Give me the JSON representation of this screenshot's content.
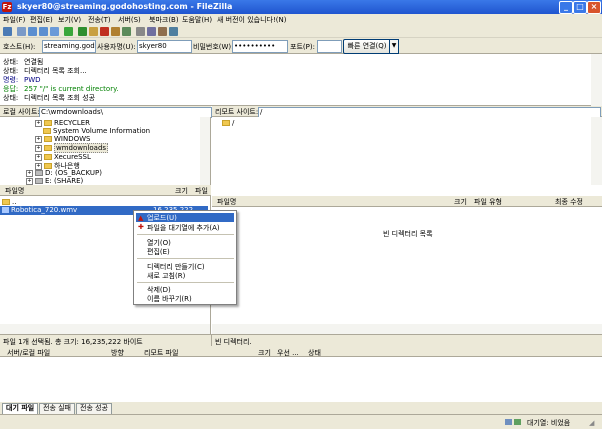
{
  "window": {
    "title": "skyer80@streaming.godohosting.com - FileZilla"
  },
  "menu": [
    "파일(F)",
    "편집(E)",
    "보기(V)",
    "전송(T)",
    "서버(S)",
    "북마크(B)",
    "도움말(H)",
    "새 버전이 있습니다!(N)"
  ],
  "quickconnect": {
    "host_label": "호스트(H):",
    "host_value": "streaming.godohos",
    "user_label": "사용자명(U):",
    "user_value": "skyer80",
    "pass_label": "비밀번호(W):",
    "pass_value": "••••••••••",
    "port_label": "포트(P):",
    "port_value": "",
    "button_label": "빠른 연결(Q)",
    "dropdown": "▼"
  },
  "log": [
    {
      "key": "상태:",
      "msg": "연결됨",
      "color": "#000000"
    },
    {
      "key": "상태:",
      "msg": "디렉터리 목록 조회...",
      "color": "#000000"
    },
    {
      "key": "명령:",
      "msg": "PWD",
      "color": "#000080"
    },
    {
      "key": "응답:",
      "msg": "257 \"/\" is current directory.",
      "color": "#008000"
    },
    {
      "key": "상태:",
      "msg": "디렉터리 목록 조회 성공",
      "color": "#000000"
    }
  ],
  "local": {
    "site_label": "로컬 사이트:",
    "path": "C:\\wmdownloads\\",
    "tree": [
      {
        "label": "RECYCLER",
        "icon": "folder-icon",
        "expand": "+"
      },
      {
        "label": "System Volume Information",
        "icon": "folder-icon",
        "expand": ""
      },
      {
        "label": "WINDOWS",
        "icon": "folder-icon",
        "expand": "+"
      },
      {
        "label": "wmdownloads",
        "icon": "folder-icon",
        "expand": "+",
        "selected": true
      },
      {
        "label": "XecureSSL",
        "icon": "folder-icon",
        "expand": "+"
      },
      {
        "label": "하나은행",
        "icon": "folder-icon",
        "expand": "+"
      },
      {
        "label": "D: (OS_BACKUP)",
        "icon": "drive-icon",
        "expand": "+"
      },
      {
        "label": "E: (SHARE)",
        "icon": "drive-icon",
        "expand": "+"
      }
    ],
    "columns": {
      "name": "파일명",
      "size": "크기",
      "type": "파일"
    },
    "files": [
      {
        "name": "..",
        "size": ""
      },
      {
        "name": "Robotica_720.wmv",
        "size": "16,235,222",
        "selected": true
      }
    ],
    "status": "파일 1개 선택됨. 총 크기: 16,235,222 바이트"
  },
  "remote": {
    "site_label": "리모트 사이트:",
    "path": "/",
    "tree": [
      {
        "label": "/",
        "icon": "folder-icon"
      }
    ],
    "columns": {
      "name": "파일명",
      "size": "크기",
      "type": "파일 유형",
      "modified": "최종 수정"
    },
    "empty_text": "빈 디렉터리 목록",
    "status": "빈 디렉터리."
  },
  "context_menu": [
    {
      "label": "업로드(U)",
      "icon": "upload-icon",
      "highlighted": true
    },
    {
      "label": "파일을 대기열에 추가(A)",
      "icon": "queue-add-icon"
    },
    {
      "sep": true
    },
    {
      "label": "열기(O)"
    },
    {
      "label": "편집(E)"
    },
    {
      "sep": true
    },
    {
      "label": "디렉터리 만들기(C)"
    },
    {
      "label": "새로 고침(R)"
    },
    {
      "sep": true
    },
    {
      "label": "삭제(D)"
    },
    {
      "label": "이름 바꾸기(R)"
    }
  ],
  "queue": {
    "columns": [
      "서버/로컬 파일",
      "방향",
      "리모트 파일",
      "크기",
      "우선 ...",
      "상태"
    ],
    "tabs": [
      "대기 파일",
      "전송 실패",
      "전송 성공"
    ],
    "status": "대기열: 비었음"
  },
  "colors": {
    "selection": "#316ac5",
    "title_bar": "#245edb",
    "chrome": "#ece9d8",
    "log_command": "#000080",
    "log_response": "#008000"
  }
}
